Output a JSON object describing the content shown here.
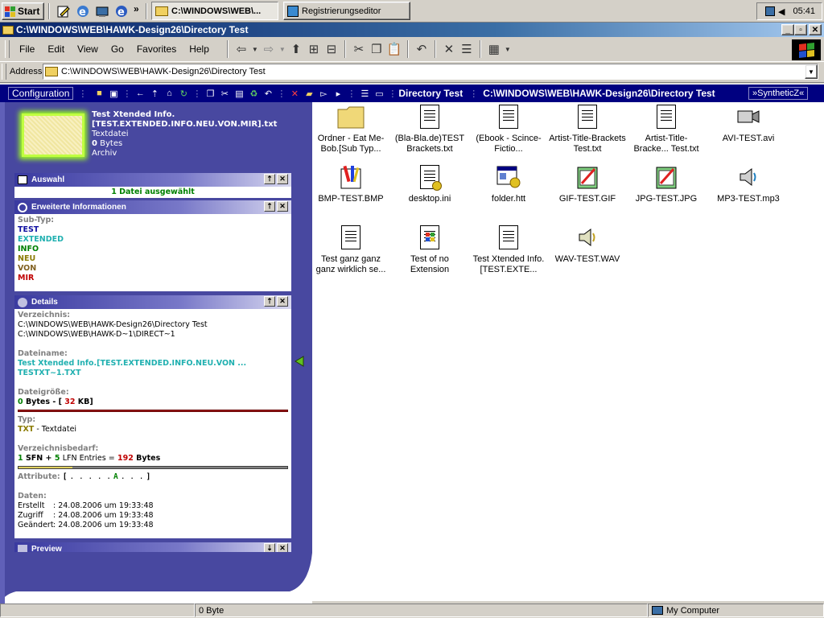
{
  "taskbar": {
    "start_label": "Start",
    "tasks": [
      {
        "label": "C:\\WINDOWS\\WEB\\..."
      },
      {
        "label": "Registrierungseditor"
      }
    ],
    "chevron": "»",
    "clock": "05:41"
  },
  "window": {
    "title": "C:\\WINDOWS\\WEB\\HAWK-Design26\\Directory Test"
  },
  "menu": {
    "items": [
      "File",
      "Edit",
      "View",
      "Go",
      "Favorites",
      "Help"
    ]
  },
  "address": {
    "label": "Address",
    "value": "C:\\WINDOWS\\WEB\\HAWK-Design26\\Directory Test"
  },
  "hawk": {
    "config_label": "Configuration",
    "folder_name": "Directory Test",
    "folder_path": "C:\\WINDOWS\\WEB\\HAWK-Design26\\Directory Test",
    "right_button": "»SyntheticZ«"
  },
  "preview": {
    "name_line1": "Test Xtended Info.",
    "name_line2": "[TEST.EXTENDED.INFO.NEU.VON.MIR].txt",
    "type": "Textdatei",
    "size_num": "0",
    "size_unit": "Bytes",
    "attr": "Archiv"
  },
  "sections": {
    "auswahl": {
      "title": "Auswahl",
      "text": "1 Datei ausgewählt"
    },
    "erweitert": {
      "title": "Erweiterte Informationen",
      "subtype_label": "Sub-Typ:",
      "items": [
        "TEST",
        "EXTENDED",
        "INFO",
        "NEU",
        "VON",
        "MIR"
      ]
    },
    "details": {
      "title": "Details",
      "dir_label": "Verzeichnis:",
      "dir_long": "C:\\WINDOWS\\WEB\\HAWK-Design26\\Directory Test",
      "dir_short": "C:\\WINDOWS\\WEB\\HAWK-D~1\\DIRECT~1",
      "name_label": "Dateiname:",
      "name_long": "Test Xtended Info.[TEST.EXTENDED.INFO.NEU.VON ...",
      "name_short": "TESTXT~1.TXT",
      "size_label": "Dateigröße:",
      "size_bytes": "0",
      "size_bytes_unit": "Bytes",
      "size_sep": "- [",
      "size_kb": "32",
      "size_kb_unit": "KB]",
      "type_label": "Typ:",
      "type_ext": "TXT",
      "type_name": "- Textdatei",
      "dirneed_label": "Verzeichnisbedarf:",
      "sfn": "1",
      "sfn_text": "SFN +",
      "lfn": "5",
      "lfn_text": "LFN Entries =",
      "dir_bytes": "192",
      "dir_bytes_unit": "Bytes",
      "attr_label": "Attribute:",
      "attr_open": "[",
      "attr_dots1": ". . . . .",
      "attr_a": "A",
      "attr_dots2": ". . .",
      "attr_close": "]",
      "dates_label": "Daten:",
      "created_label": "Erstellt",
      "created": ": 24.08.2006 um 19:33:48",
      "accessed_label": "Zugriff",
      "accessed": ": 24.08.2006 um 19:33:48",
      "modified_label": "Geändert",
      "modified": ": 24.08.2006 um 19:33:48"
    },
    "preview": {
      "title": "Preview"
    }
  },
  "files": [
    {
      "name": "Ordner - Eat Me-Bob.[Sub Typ...",
      "icon": "folder-icon"
    },
    {
      "name": "(Bla-Bla.de)TEST Brackets.txt",
      "icon": "text-file-icon"
    },
    {
      "name": "(Ebook - Scince-Fictio...",
      "icon": "text-file-icon"
    },
    {
      "name": "Artist-Title-Brackets Test.txt",
      "icon": "text-file-icon"
    },
    {
      "name": "Artist-Title-Bracke... Test.txt",
      "icon": "text-file-icon"
    },
    {
      "name": "AVI-TEST.avi",
      "icon": "video-file-icon"
    },
    {
      "name": "BMP-TEST.BMP",
      "icon": "bitmap-file-icon"
    },
    {
      "name": "desktop.ini",
      "icon": "settings-file-icon"
    },
    {
      "name": "folder.htt",
      "icon": "htt-file-icon"
    },
    {
      "name": "GIF-TEST.GIF",
      "icon": "image-file-icon"
    },
    {
      "name": "JPG-TEST.JPG",
      "icon": "image-file-icon"
    },
    {
      "name": "MP3-TEST.mp3",
      "icon": "audio-file-icon"
    },
    {
      "name": "Test ganz ganz ganz wirklich se...",
      "icon": "text-file-icon"
    },
    {
      "name": "Test of no Extension",
      "icon": "windows-file-icon"
    },
    {
      "name": "Test Xtended Info.[TEST.EXTE...",
      "icon": "text-file-icon"
    },
    {
      "name": "WAV-TEST.WAV",
      "icon": "audio-file-icon"
    }
  ],
  "status": {
    "left": "",
    "size": "0 Byte",
    "zone": "My Computer"
  },
  "colors": {
    "accent": "#000080",
    "panel": "#4848a0",
    "cyan": "#20b0b0",
    "green": "#008000",
    "red": "#c00000",
    "olive": "#8a7a00"
  }
}
